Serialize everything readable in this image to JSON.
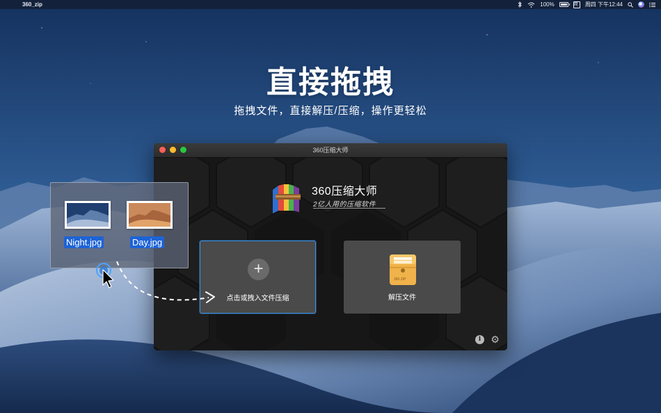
{
  "menubar": {
    "app_name": "360_zip",
    "battery_percent": "100%",
    "input_method": "简",
    "clock": "周四 下午12:44",
    "search_icon": "magnifier-icon",
    "control_icon": "list-icon"
  },
  "hero": {
    "title": "直接拖拽",
    "subtitle": "拖拽文件，直接解压/压缩，操作更轻松"
  },
  "window": {
    "title": "360压缩大师",
    "brand_name": "360压缩大师",
    "brand_tagline": "2亿人用的压缩软件",
    "compress_label": "点击或拽入文件压缩",
    "extract_label": "解压文件",
    "info_glyph": "i",
    "settings_glyph": "⚙",
    "plus_glyph": "+",
    "zip_badge": "360 ZIP"
  },
  "drag_panel": {
    "files": [
      {
        "name": "Night.jpg"
      },
      {
        "name": "Day.jpg"
      }
    ]
  },
  "colors": {
    "accent": "#3b8fe3",
    "file_label_bg": "#1d63d6",
    "card_bg": "#4a4a4a",
    "window_bg": "#161616"
  }
}
